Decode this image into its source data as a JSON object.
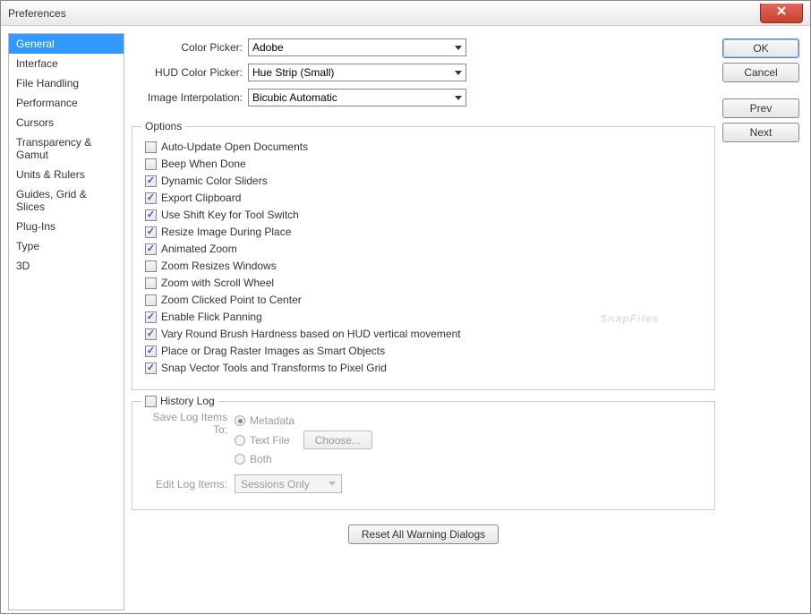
{
  "window": {
    "title": "Preferences"
  },
  "sidebar": {
    "items": [
      "General",
      "Interface",
      "File Handling",
      "Performance",
      "Cursors",
      "Transparency & Gamut",
      "Units & Rulers",
      "Guides, Grid & Slices",
      "Plug-Ins",
      "Type",
      "3D"
    ],
    "activeIndex": 0
  },
  "pickers": {
    "colorPickerLabel": "Color Picker:",
    "colorPickerValue": "Adobe",
    "hudLabel": "HUD Color Picker:",
    "hudValue": "Hue Strip (Small)",
    "interpLabel": "Image Interpolation:",
    "interpValue": "Bicubic Automatic"
  },
  "optionsTitle": "Options",
  "options": [
    {
      "label": "Auto-Update Open Documents",
      "checked": false
    },
    {
      "label": "Beep When Done",
      "checked": false
    },
    {
      "label": "Dynamic Color Sliders",
      "checked": true
    },
    {
      "label": "Export Clipboard",
      "checked": true
    },
    {
      "label": "Use Shift Key for Tool Switch",
      "checked": true
    },
    {
      "label": "Resize Image During Place",
      "checked": true
    },
    {
      "label": "Animated Zoom",
      "checked": true
    },
    {
      "label": "Zoom Resizes Windows",
      "checked": false
    },
    {
      "label": "Zoom with Scroll Wheel",
      "checked": false
    },
    {
      "label": "Zoom Clicked Point to Center",
      "checked": false
    },
    {
      "label": "Enable Flick Panning",
      "checked": true
    },
    {
      "label": "Vary Round Brush Hardness based on HUD vertical movement",
      "checked": true
    },
    {
      "label": "Place or Drag Raster Images as Smart Objects",
      "checked": true
    },
    {
      "label": "Snap Vector Tools and Transforms to Pixel Grid",
      "checked": true
    }
  ],
  "history": {
    "title": "History Log",
    "checked": false,
    "saveLabel": "Save Log Items To:",
    "radios": {
      "metadata": "Metadata",
      "textfile": "Text File",
      "both": "Both"
    },
    "selectedRadio": "metadata",
    "chooseBtn": "Choose...",
    "editLabel": "Edit Log Items:",
    "editValue": "Sessions Only"
  },
  "resetBtn": "Reset All Warning Dialogs",
  "buttons": {
    "ok": "OK",
    "cancel": "Cancel",
    "prev": "Prev",
    "next": "Next"
  },
  "watermark": "SnapFiles"
}
